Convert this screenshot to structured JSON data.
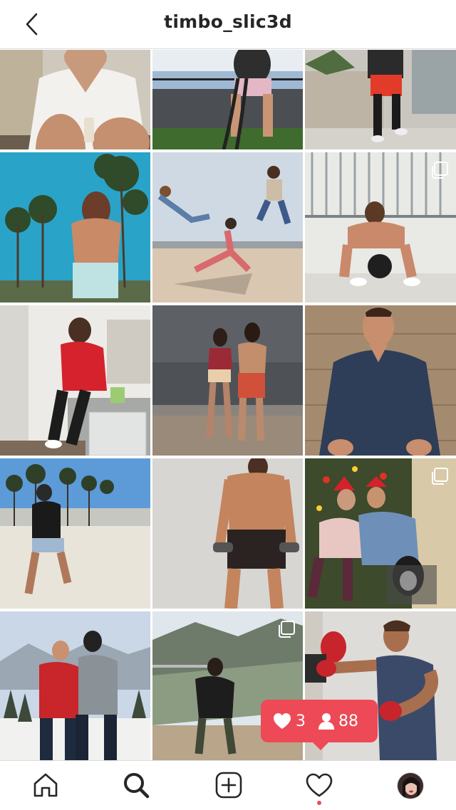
{
  "header": {
    "username": "timbo_slic3d",
    "back_icon": "chevron-left-icon"
  },
  "posts": [
    {
      "label": "man in white v-neck holding drink",
      "multi": false
    },
    {
      "label": "battle ropes workout on rooftop",
      "multi": false
    },
    {
      "label": "man running in red shorts",
      "multi": false
    },
    {
      "label": "shirtless man under palm trees",
      "multi": false
    },
    {
      "label": "three people jumping workout",
      "multi": false
    },
    {
      "label": "man squatting with medicine ball",
      "multi": true
    },
    {
      "label": "man in red shirt in kitchen",
      "multi": false
    },
    {
      "label": "couple on beach at dusk",
      "multi": false
    },
    {
      "label": "man in navy dress shirt",
      "multi": false
    },
    {
      "label": "man lunging on beach",
      "multi": false
    },
    {
      "label": "shirtless man with dumbbells",
      "multi": false
    },
    {
      "label": "couple with dog at christmas",
      "multi": true
    },
    {
      "label": "two men on snowy mountain",
      "multi": false
    },
    {
      "label": "man on coastal hillside",
      "multi": true
    },
    {
      "label": "boxing training with pads",
      "multi": false
    }
  ],
  "notification": {
    "likes": "3",
    "follows": "88",
    "color": "#ed4956"
  },
  "tabbar": {
    "home": "home-icon",
    "search": "search-icon",
    "add": "add-post-icon",
    "activity": "heart-icon",
    "profile": "profile-avatar"
  }
}
